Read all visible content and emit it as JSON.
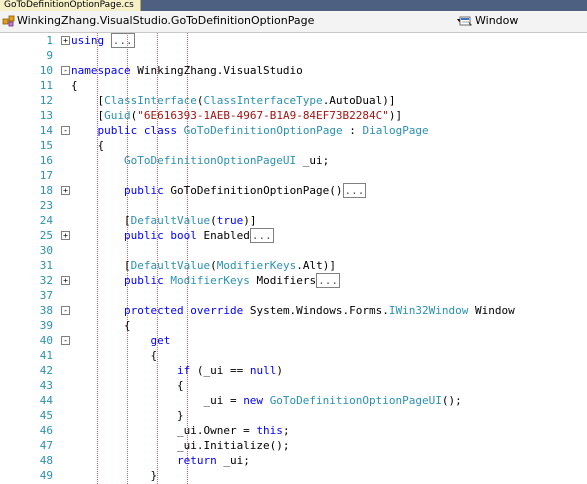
{
  "document_tab": {
    "label": "GoToDefinitionOptionPage.cs"
  },
  "navigation_bar": {
    "type_combo": {
      "value": "WinkingZhang.VisualStudio.GoToDefinitionOptionPage"
    },
    "member_combo": {
      "value": "Window"
    }
  },
  "editor": {
    "collapsed_marker": "...",
    "lines": [
      {
        "num": "1",
        "outline": "+",
        "tokens": [
          {
            "t": "using",
            "c": "kw"
          },
          {
            "t": " "
          },
          {
            "t": "...",
            "c": "collapsed"
          }
        ]
      },
      {
        "num": "9",
        "outline": "",
        "tokens": []
      },
      {
        "num": "10",
        "outline": "-",
        "tokens": [
          {
            "t": "namespace",
            "c": "kw"
          },
          {
            "t": " WinkingZhang.VisualStudio"
          }
        ]
      },
      {
        "num": "11",
        "outline": "",
        "tokens": [
          {
            "t": "{"
          }
        ]
      },
      {
        "num": "12",
        "outline": "",
        "tokens": [
          {
            "t": "    ["
          },
          {
            "t": "ClassInterface",
            "c": "ty"
          },
          {
            "t": "("
          },
          {
            "t": "ClassInterfaceType",
            "c": "ty"
          },
          {
            "t": ".AutoDual)]"
          }
        ]
      },
      {
        "num": "13",
        "outline": "",
        "tokens": [
          {
            "t": "    ["
          },
          {
            "t": "Guid",
            "c": "ty"
          },
          {
            "t": "("
          },
          {
            "t": "\"6E616393-1AEB-4967-B1A9-84EF73B2284C\"",
            "c": "st"
          },
          {
            "t": ")]"
          }
        ]
      },
      {
        "num": "14",
        "outline": "-",
        "tokens": [
          {
            "t": "    "
          },
          {
            "t": "public",
            "c": "kw"
          },
          {
            "t": " "
          },
          {
            "t": "class",
            "c": "kw"
          },
          {
            "t": " "
          },
          {
            "t": "GoToDefinitionOptionPage",
            "c": "ty"
          },
          {
            "t": " : "
          },
          {
            "t": "DialogPage",
            "c": "ty"
          }
        ]
      },
      {
        "num": "15",
        "outline": "",
        "tokens": [
          {
            "t": "    {"
          }
        ]
      },
      {
        "num": "16",
        "outline": "",
        "tokens": [
          {
            "t": "        "
          },
          {
            "t": "GoToDefinitionOptionPageUI",
            "c": "ty"
          },
          {
            "t": " _ui;"
          }
        ]
      },
      {
        "num": "17",
        "outline": "",
        "tokens": []
      },
      {
        "num": "18",
        "outline": "+",
        "tokens": [
          {
            "t": "        "
          },
          {
            "t": "public",
            "c": "kw"
          },
          {
            "t": " GoToDefinitionOptionPage()"
          },
          {
            "t": "...",
            "c": "collapsed"
          }
        ]
      },
      {
        "num": "23",
        "outline": "",
        "tokens": []
      },
      {
        "num": "24",
        "outline": "",
        "tokens": [
          {
            "t": "        ["
          },
          {
            "t": "DefaultValue",
            "c": "ty"
          },
          {
            "t": "("
          },
          {
            "t": "true",
            "c": "kw"
          },
          {
            "t": ")]"
          }
        ]
      },
      {
        "num": "25",
        "outline": "+",
        "tokens": [
          {
            "t": "        "
          },
          {
            "t": "public",
            "c": "kw"
          },
          {
            "t": " "
          },
          {
            "t": "bool",
            "c": "kw"
          },
          {
            "t": " Enabled"
          },
          {
            "t": "...",
            "c": "collapsed"
          }
        ]
      },
      {
        "num": "30",
        "outline": "",
        "tokens": []
      },
      {
        "num": "31",
        "outline": "",
        "tokens": [
          {
            "t": "        ["
          },
          {
            "t": "DefaultValue",
            "c": "ty"
          },
          {
            "t": "("
          },
          {
            "t": "ModifierKeys",
            "c": "ty"
          },
          {
            "t": ".Alt)]"
          }
        ]
      },
      {
        "num": "32",
        "outline": "+",
        "tokens": [
          {
            "t": "        "
          },
          {
            "t": "public",
            "c": "kw"
          },
          {
            "t": " "
          },
          {
            "t": "ModifierKeys",
            "c": "ty"
          },
          {
            "t": " Modifiers"
          },
          {
            "t": "...",
            "c": "collapsed"
          }
        ]
      },
      {
        "num": "37",
        "outline": "",
        "tokens": []
      },
      {
        "num": "38",
        "outline": "-",
        "tokens": [
          {
            "t": "        "
          },
          {
            "t": "protected",
            "c": "kw"
          },
          {
            "t": " "
          },
          {
            "t": "override",
            "c": "kw"
          },
          {
            "t": " System.Windows.Forms."
          },
          {
            "t": "IWin32Window",
            "c": "ty"
          },
          {
            "t": " Window"
          }
        ]
      },
      {
        "num": "39",
        "outline": "",
        "tokens": [
          {
            "t": "        {"
          }
        ]
      },
      {
        "num": "40",
        "outline": "-",
        "tokens": [
          {
            "t": "            "
          },
          {
            "t": "get",
            "c": "kw"
          }
        ]
      },
      {
        "num": "41",
        "outline": "",
        "tokens": [
          {
            "t": "            {"
          }
        ]
      },
      {
        "num": "42",
        "outline": "",
        "tokens": [
          {
            "t": "                "
          },
          {
            "t": "if",
            "c": "kw"
          },
          {
            "t": " (_ui == "
          },
          {
            "t": "null",
            "c": "kw"
          },
          {
            "t": ")"
          }
        ]
      },
      {
        "num": "43",
        "outline": "",
        "tokens": [
          {
            "t": "                {"
          }
        ]
      },
      {
        "num": "44",
        "outline": "",
        "tokens": [
          {
            "t": "                    _ui = "
          },
          {
            "t": "new",
            "c": "kw"
          },
          {
            "t": " "
          },
          {
            "t": "GoToDefinitionOptionPageUI",
            "c": "ty"
          },
          {
            "t": "();"
          }
        ]
      },
      {
        "num": "45",
        "outline": "",
        "tokens": [
          {
            "t": "                }"
          }
        ]
      },
      {
        "num": "46",
        "outline": "",
        "tokens": [
          {
            "t": "                _ui.Owner = "
          },
          {
            "t": "this",
            "c": "kw"
          },
          {
            "t": ";"
          }
        ]
      },
      {
        "num": "47",
        "outline": "",
        "tokens": [
          {
            "t": "                _ui.Initialize();"
          }
        ]
      },
      {
        "num": "48",
        "outline": "",
        "tokens": [
          {
            "t": "                "
          },
          {
            "t": "return",
            "c": "kw"
          },
          {
            "t": " _ui;"
          }
        ]
      },
      {
        "num": "49",
        "outline": "",
        "tokens": [
          {
            "t": "            }"
          }
        ]
      }
    ]
  }
}
